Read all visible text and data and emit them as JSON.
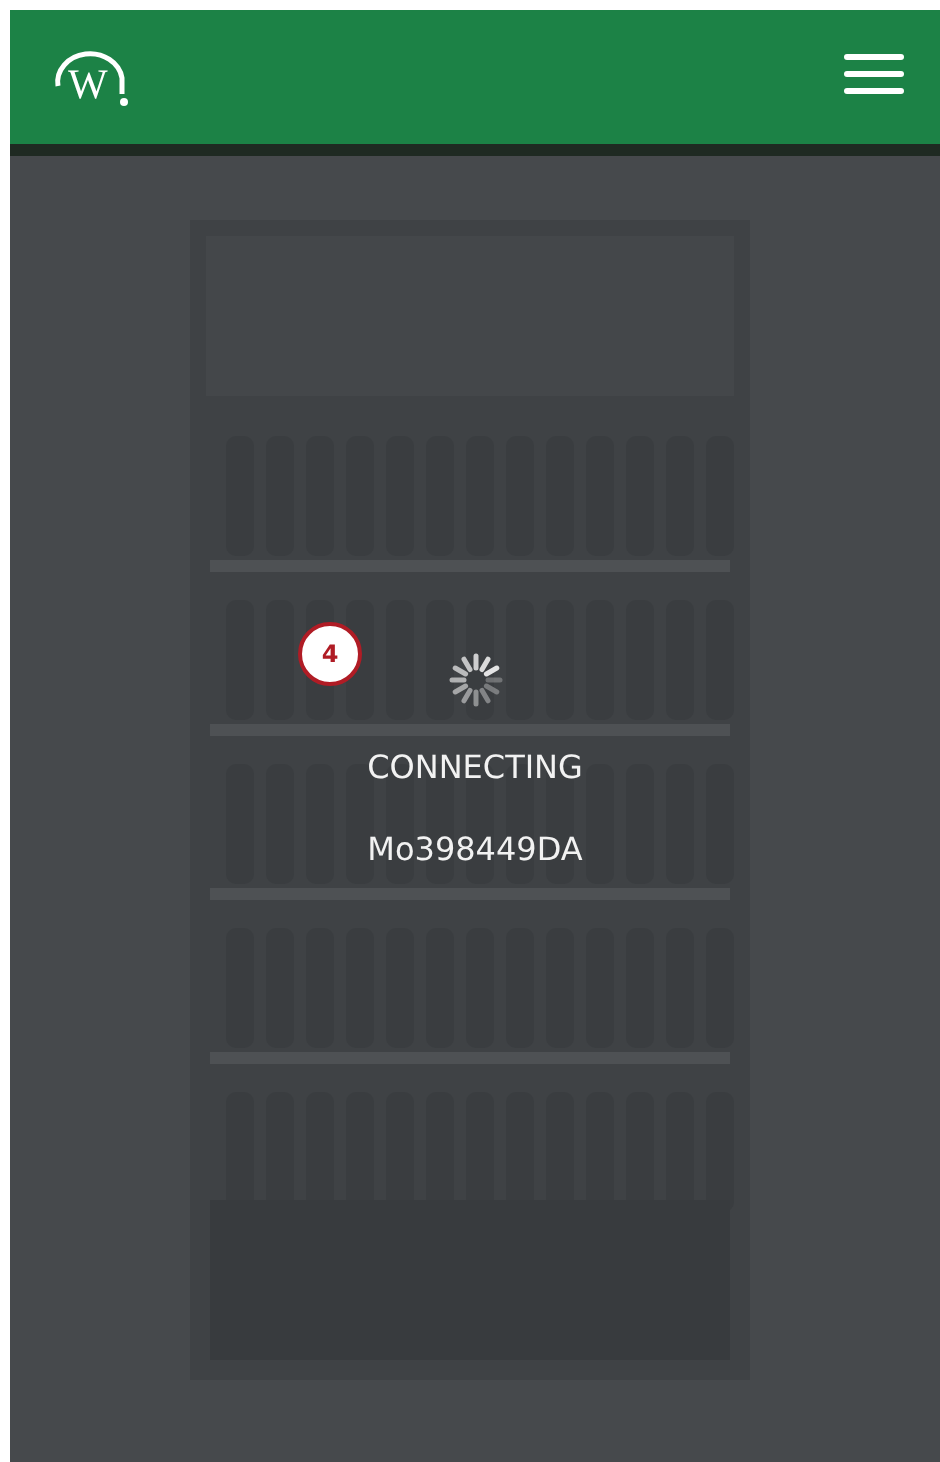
{
  "header": {
    "logo_text": "W"
  },
  "status": {
    "badge": "4",
    "message": "CONNECTING",
    "device_id": "Mo398449DA"
  }
}
